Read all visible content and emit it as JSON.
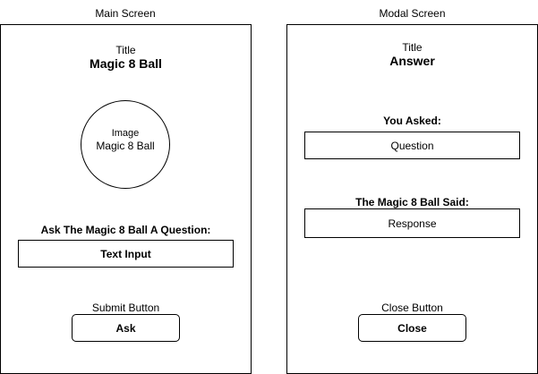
{
  "main_screen": {
    "label": "Main Screen",
    "title_caption": "Title",
    "title_text": "Magic 8 Ball",
    "image_caption": "Image",
    "image_text": "Magic 8 Ball",
    "question_label": "Ask The Magic 8 Ball A Question:",
    "input_text": "Text Input",
    "submit_caption": "Submit Button",
    "submit_label": "Ask"
  },
  "modal_screen": {
    "label": "Modal Screen",
    "title_caption": "Title",
    "title_text": "Answer",
    "asked_label": "You Asked:",
    "question_text": "Question",
    "said_label": "The Magic 8 Ball Said:",
    "response_text": "Response",
    "close_caption": "Close Button",
    "close_label": "Close"
  }
}
